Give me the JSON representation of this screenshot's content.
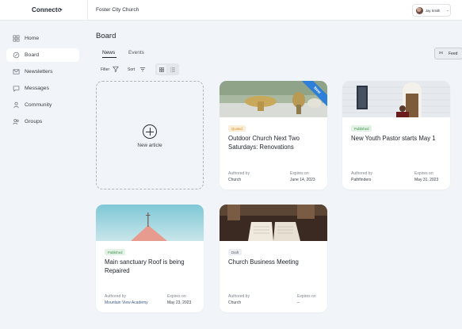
{
  "app": {
    "logo": "Connect",
    "org_name": "Foster City Church",
    "user_name": "Jay Smith"
  },
  "sidebar": {
    "items": [
      {
        "label": "Home",
        "icon": "home-icon"
      },
      {
        "label": "Board",
        "icon": "board-icon",
        "active": true
      },
      {
        "label": "Newsletters",
        "icon": "mail-icon"
      },
      {
        "label": "Messages",
        "icon": "message-icon"
      },
      {
        "label": "Community",
        "icon": "person-icon"
      },
      {
        "label": "Groups",
        "icon": "group-icon"
      }
    ]
  },
  "main": {
    "title": "Board",
    "tabs": [
      {
        "label": "News",
        "active": true
      },
      {
        "label": "Events"
      }
    ],
    "feed_label": "Feed",
    "filter_label": "Filter",
    "sort_label": "Sort",
    "new_article_label": "New article"
  },
  "cards": [
    {
      "status": "Quoted",
      "title": "Outdoor Church Next Two Saturdays: Renovations",
      "authored_label": "Authored by",
      "author": "Church",
      "expires_label": "Expires on",
      "expires": "June 14, 2023",
      "ribbon": "New"
    },
    {
      "status": "Published",
      "title": "New Youth Pastor starts May 1",
      "authored_label": "Authored by",
      "author": "Pathfinders",
      "expires_label": "Expires on",
      "expires": "May 31, 2023"
    },
    {
      "status": "Published",
      "title": "Main sanctuary Roof is being Repaired",
      "authored_label": "Authored by",
      "author": "Mountain View Academy",
      "expires_label": "Expires on",
      "expires": "May 23, 2023"
    },
    {
      "status": "Draft",
      "title": "Church Business Meeting",
      "authored_label": "Authored by",
      "author": "Church",
      "expires_label": "Expires on",
      "expires": "–"
    }
  ],
  "colors": {
    "accent": "#2e7fd8",
    "background": "#f1f4f8"
  }
}
